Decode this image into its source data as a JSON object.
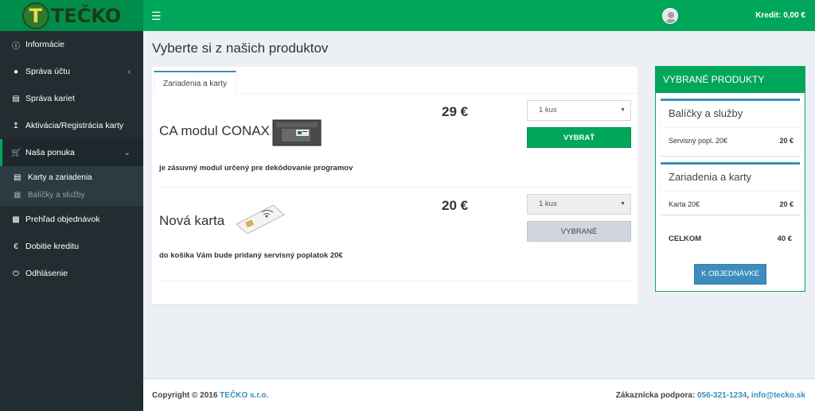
{
  "header": {
    "logo_letter": "T",
    "logo_text": "TEČKO",
    "menu_icon": "hamburger-icon",
    "credit_label": "Kredit: 0,00 €"
  },
  "sidebar": {
    "items": [
      {
        "label": "Informácie",
        "icon": "info-icon"
      },
      {
        "label": "Správa účtu",
        "icon": "user-icon"
      },
      {
        "label": "Správa kariet",
        "icon": "credit-card-icon"
      },
      {
        "label": "Aktivácia/Registrácia karty",
        "icon": "upload-icon"
      },
      {
        "label": "Naša ponuka",
        "icon": "cart-icon"
      },
      {
        "label": "Prehľad objednávok",
        "icon": "bar-chart-icon"
      },
      {
        "label": "Dobitie kreditu",
        "icon": "euro-icon"
      },
      {
        "label": "Odhlásenie",
        "icon": "power-icon"
      }
    ],
    "submenu": [
      {
        "label": "Karty a zariadenia",
        "icon": "credit-card-icon"
      },
      {
        "label": "Balíčky a služby",
        "icon": "film-icon"
      }
    ]
  },
  "main": {
    "title": "Vyberte si z našich produktov",
    "tab": "Zariadenia a karty",
    "products": [
      {
        "name": "CA modul CONAX",
        "price": "29 €",
        "description": "je zásuvný modul určený pre dekódovanie programov",
        "quantity": "1 kus",
        "button": "VYBRAŤ",
        "image": "ca-module-image"
      },
      {
        "name": "Nová karta",
        "price": "20 €",
        "description": "do košíka Vám bude pridaný servisný poplatok 20€",
        "quantity": "1 kus",
        "button": "VYBRANÉ",
        "image": "smart-card-image"
      }
    ]
  },
  "selected": {
    "title": "VYBRANÉ PRODUKTY",
    "sections": [
      {
        "title": "Balíčky a služby",
        "item": "Servisný popl. 20€",
        "value": "20 €"
      },
      {
        "title": "Zariadenia a karty",
        "item": "Karta 20€",
        "value": "20 €"
      }
    ],
    "total_label": "CELKOM",
    "total_value": "40 €",
    "order_button": "K OBJEDNÁVKE"
  },
  "footer": {
    "copyright": "Copyright © 2016",
    "company": "TEČKO s.r.o.",
    "support_label": "Zákaznícka podpora:",
    "phone": "056-321-1234",
    "separator": ",",
    "email": "info@tecko.sk"
  },
  "colors": {
    "brand_green": "#00a65a",
    "sidebar_bg": "#222d32",
    "accent_blue": "#3c8dbc"
  }
}
